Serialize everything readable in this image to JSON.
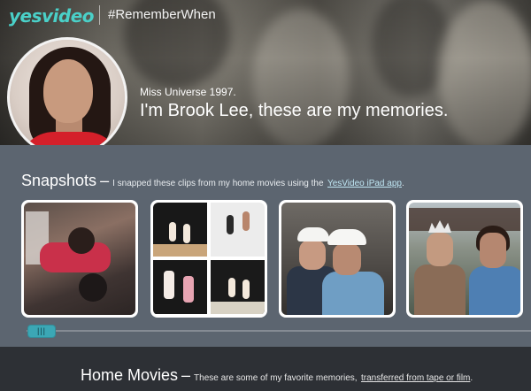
{
  "header": {
    "logo": "yesvideo",
    "hashtag": "#RememberWhen"
  },
  "hero": {
    "subtitle": "Miss Universe 1997.",
    "title": "I'm Brook Lee, these are my memories."
  },
  "snapshots": {
    "title": "Snapshots",
    "dash": "–",
    "description": "I snapped these clips from my home movies using the",
    "link": "YesVideo iPad app",
    "after_link": ".",
    "scroll_handle": "|||"
  },
  "home_movies": {
    "title": "Home Movies",
    "dash": "–",
    "description": "These are some of my favorite memories,",
    "link": "transferred from tape or film",
    "after_link": "."
  },
  "colors": {
    "brand_teal": "#4ad0c8",
    "scroll_thumb": "#3ba7b5",
    "section_bg": "#5c6570",
    "footer_bg": "#2d3035"
  }
}
